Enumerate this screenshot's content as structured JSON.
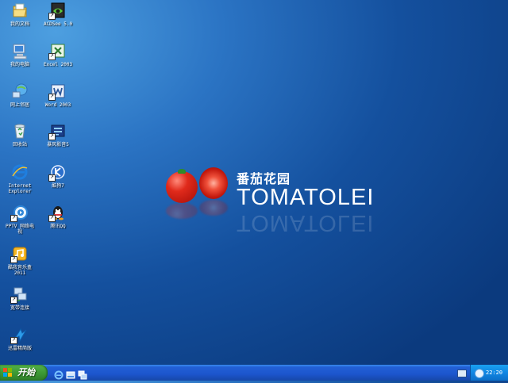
{
  "desktop": {
    "icons": [
      {
        "label": "我的文档",
        "icon": "my-documents-icon"
      },
      {
        "label": "ACDSee 5.0",
        "icon": "acdsee-icon"
      },
      {
        "label": "我的电脑",
        "icon": "my-computer-icon"
      },
      {
        "label": "Excel 2003",
        "icon": "excel-icon"
      },
      {
        "label": "网上邻居",
        "icon": "network-icon"
      },
      {
        "label": "Word 2003",
        "icon": "word-icon"
      },
      {
        "label": "回收站",
        "icon": "recycle-bin-icon"
      },
      {
        "label": "暴风影音5",
        "icon": "baofeng-icon"
      },
      {
        "label": "Internet\nExplorer",
        "icon": "ie-icon"
      },
      {
        "label": "酷狗7",
        "icon": "kugou-icon"
      },
      {
        "label": "PPTV 网络电\n视",
        "icon": "pptv-icon"
      },
      {
        "label": "腾讯QQ",
        "icon": "qq-icon"
      },
      {
        "label": "酷我音乐盒\n2011",
        "icon": "kuwo-icon"
      },
      {
        "label": "宽带连接",
        "icon": "broadband-icon"
      },
      {
        "label": "迅雷精简版",
        "icon": "thunder-icon"
      }
    ]
  },
  "wallpaper": {
    "brand_cn": "番茄花园",
    "brand_en": "TOMATOLEI"
  },
  "taskbar": {
    "start_label": "开始",
    "quick_launch": [
      "ie-icon",
      "show-desktop-icon",
      "switch-windows-icon"
    ],
    "clock": "22:20"
  },
  "colors": {
    "desktop_blue": "#14509e",
    "taskbar_blue": "#1c55cc",
    "start_green": "#3d9a35",
    "tray_blue": "#0f86e3"
  }
}
